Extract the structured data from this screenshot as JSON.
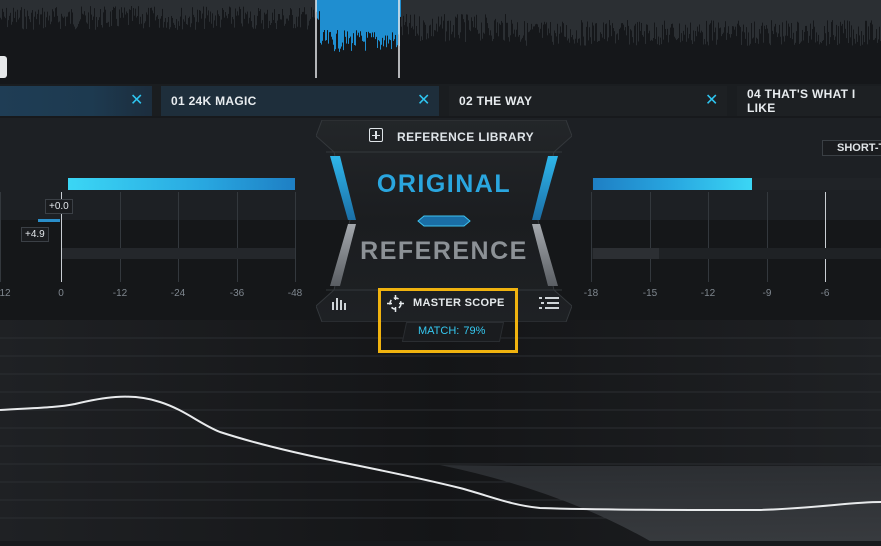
{
  "tabs": [
    {
      "label": "01 24K MAGIC",
      "close": "✕"
    },
    {
      "label": "02 THE WAY",
      "close": "✕"
    },
    {
      "label": "04 THAT'S WHAT I LIKE",
      "close": ""
    }
  ],
  "first_tab_close": "✕",
  "reference_library": {
    "label": "REFERENCE LIBRARY",
    "icon": "plus-square-icon"
  },
  "modes": {
    "original": "ORIGINAL",
    "reference": "REFERENCE"
  },
  "master_scope": {
    "label": "MASTER SCOPE",
    "icon": "crosshair-scope-icon"
  },
  "match": {
    "label": "MATCH:",
    "value": "79%"
  },
  "short_term_button": "SHORT-T",
  "left_meter": {
    "scale": [
      "12",
      "0",
      "-12",
      "-24",
      "-36",
      "-48"
    ],
    "value_top": "+0.0",
    "value_bottom": "+4.9",
    "fill_top": 1.0
  },
  "right_meter": {
    "scale": [
      "-18",
      "-15",
      "-12",
      "-9",
      "-6"
    ],
    "fill_top": 0.59
  },
  "colors": {
    "accent": "#2aa6df",
    "highlight": "#f0b30f",
    "match": "#35c8f0"
  }
}
